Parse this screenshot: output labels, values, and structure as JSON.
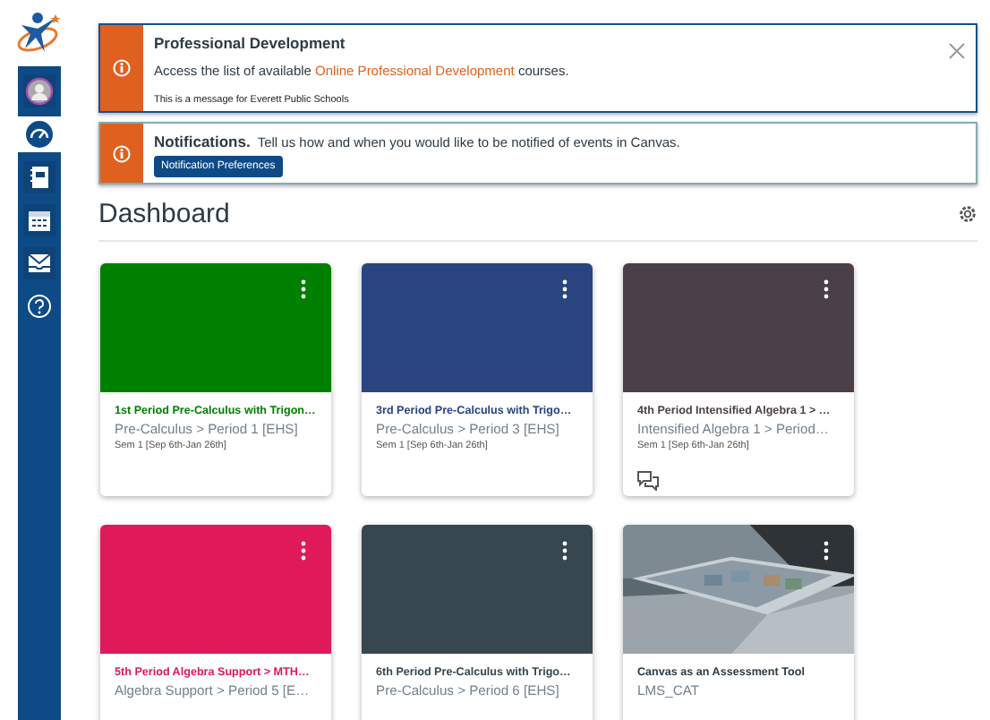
{
  "sidebar": {
    "items": [
      {
        "kind": "account",
        "selected": false
      },
      {
        "kind": "dashboard",
        "selected": true
      },
      {
        "kind": "courses",
        "selected": false
      },
      {
        "kind": "calendar",
        "selected": false
      },
      {
        "kind": "inbox",
        "selected": false
      },
      {
        "kind": "help",
        "selected": false
      }
    ]
  },
  "banners": [
    {
      "kind": "announcement",
      "title": "Professional Development",
      "text": "Access the list of available ",
      "link": "Online Professional Development",
      "text_after": " courses.",
      "footer": "This is a message for Everett Public Schools",
      "closable": true
    },
    {
      "kind": "notification",
      "title": "Notifications.",
      "text": "Tell us how and when you would like to be notified of events in Canvas.",
      "button": "Notification Preferences",
      "closable": false
    }
  ],
  "dashboard": {
    "title": "Dashboard"
  },
  "cards": [
    {
      "kind": "color",
      "color": "#008000",
      "title": "1st Period Pre-Calculus with Trigon…",
      "subtitle": "Pre-Calculus > Period 1 [EHS]",
      "term": "Sem 1 [Sep 6th-Jan 26th]",
      "discussions": false
    },
    {
      "kind": "color",
      "color": "#2a4480",
      "title": "3rd Period Pre-Calculus with Trigo…",
      "subtitle": "Pre-Calculus > Period 3 [EHS]",
      "term": "Sem 1 [Sep 6th-Jan 26th]",
      "discussions": false
    },
    {
      "kind": "color",
      "color": "#4a3f48",
      "title": "4th Period Intensified Algebra 1 > …",
      "subtitle": "Intensified Algebra 1 > Period…",
      "term": "Sem 1 [Sep 6th-Jan 26th]",
      "discussions": true
    },
    {
      "kind": "color",
      "color": "#e0195a",
      "title": "5th Period Algebra Support > MTH…",
      "subtitle": "Algebra Support > Period 5 [E…",
      "discussions": false
    },
    {
      "kind": "color",
      "color": "#37474f",
      "title": "6th Period Pre-Calculus with Trigo…",
      "subtitle": "Pre-Calculus > Period 6 [EHS]",
      "discussions": false
    },
    {
      "kind": "picture",
      "title": "Canvas as an Assessment Tool",
      "subtitle": "LMS_CAT",
      "discussions": false
    }
  ]
}
